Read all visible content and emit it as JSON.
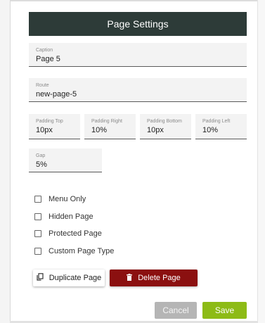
{
  "dialog": {
    "title": "Page Settings"
  },
  "fields": {
    "caption": {
      "label": "Caption",
      "value": "Page 5"
    },
    "route": {
      "label": "Route",
      "value": "new-page-5"
    },
    "padding_top": {
      "label": "Padding Top",
      "value": "10px"
    },
    "padding_right": {
      "label": "Padding Right",
      "value": "10%"
    },
    "padding_bottom": {
      "label": "Padding Bottom",
      "value": "10px"
    },
    "padding_left": {
      "label": "Padding Left",
      "value": "10%"
    },
    "gap": {
      "label": "Gap",
      "value": "5%"
    }
  },
  "checkboxes": [
    {
      "label": "Menu Only",
      "checked": false
    },
    {
      "label": "Hidden Page",
      "checked": false
    },
    {
      "label": "Protected Page",
      "checked": false
    },
    {
      "label": "Custom Page Type",
      "checked": false
    }
  ],
  "actions": {
    "duplicate_label": "Duplicate Page",
    "delete_label": "Delete Page",
    "cancel_label": "Cancel",
    "save_label": "Save"
  },
  "colors": {
    "header": "#2d3b38",
    "delete": "#8b1010",
    "save": "#8dbb16",
    "cancel": "#b5b5b5"
  },
  "icons": {
    "duplicate": "copy-icon",
    "delete": "trash-icon"
  }
}
